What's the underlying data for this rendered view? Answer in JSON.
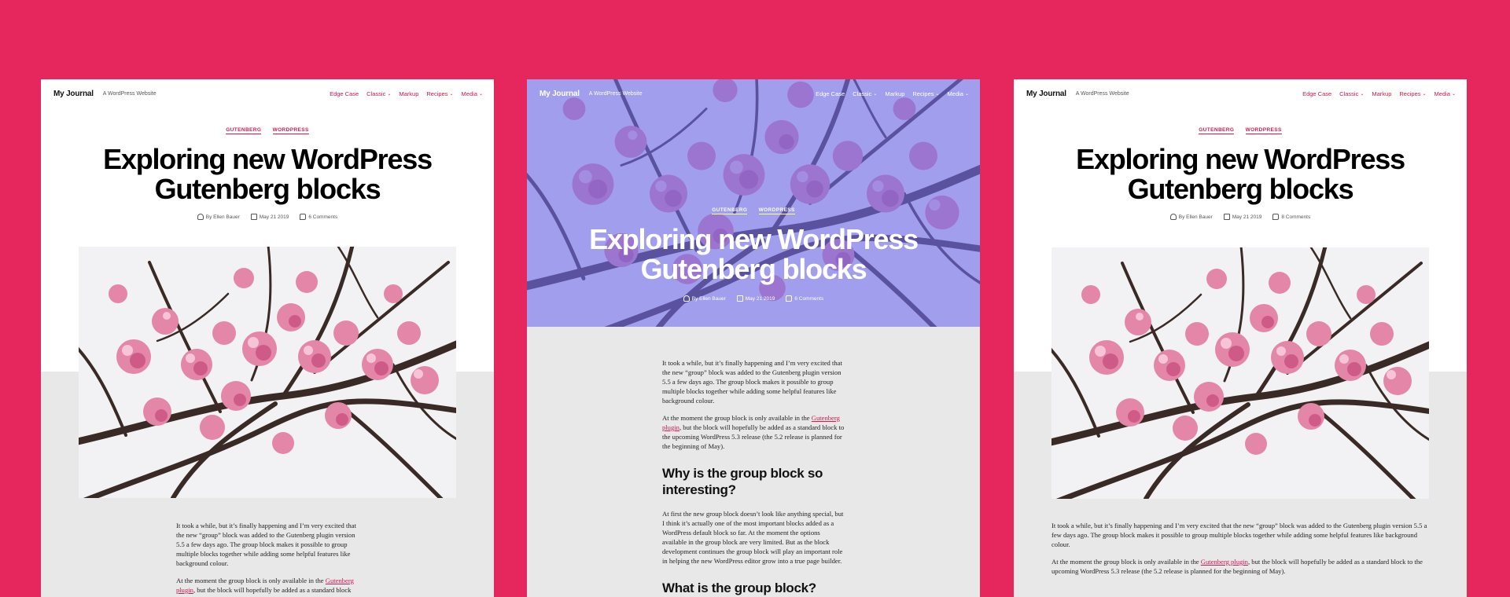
{
  "site": {
    "brand": "My Journal",
    "tagline": "A WordPress Website",
    "nav": [
      "Edge Case",
      "Classic",
      "Markup",
      "Recipes",
      "Media"
    ],
    "nav_dropdowns": [
      false,
      true,
      false,
      true,
      true
    ]
  },
  "post": {
    "categories": [
      "GUTENBERG",
      "WORDPRESS"
    ],
    "title": "Exploring new WordPress Gutenberg blocks",
    "author": "By Ellen Bauer",
    "date": "May 21 2019",
    "comments": "6 Comments",
    "comments_alt": "8 Comments"
  },
  "content": {
    "p1": "It took a while, but it’s finally happening and I’m very excited that the new “group” block was added to the Gutenberg plugin version 5.5 a few days ago. The group block makes it possible to group multiple blocks together while adding some helpful features like background colour.",
    "p2_before": "At the moment the group block is only available in the ",
    "p2_link": "Gutenberg plugin",
    "p2_after": ", but the block will hopefully be added as a standard block to the upcoming WordPress 5.3 release (the 5.2 release is planned for the beginning of May).",
    "h2_a": "Why is the group block so interesting?",
    "p3": "At first the new group block doesn’t look like anything special, but I think it’s actually one of the most important blocks added as a WordPress default block so far. At the moment the options available in the group block are very limited. But as the block development continues the group block will play an important role in helping the new WordPress editor grow into a true page builder.",
    "h2_b": "What is the group block?"
  },
  "colors": {
    "background": "#e6275e",
    "accent": "#d6184d",
    "cover_overlay": "#8d87e6",
    "content_bg": "#e9e8e8"
  },
  "icons": {
    "chevron": "chevron-down-icon",
    "author": "person-icon",
    "date": "calendar-icon",
    "comments": "comment-icon"
  }
}
